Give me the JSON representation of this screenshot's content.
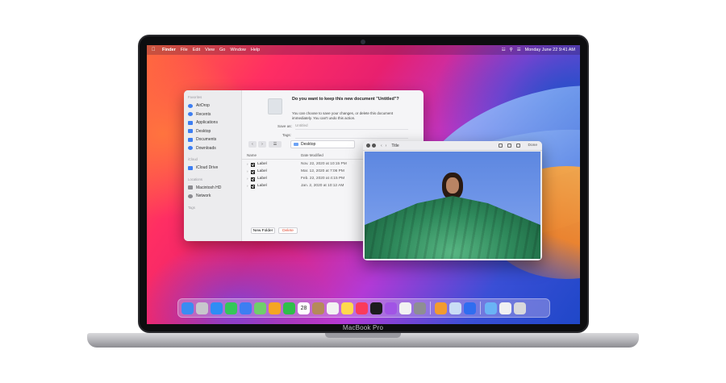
{
  "menubar": {
    "app": "Finder",
    "items": [
      "File",
      "Edit",
      "View",
      "Go",
      "Window",
      "Help"
    ],
    "clock": "Monday June 22  9:41 AM"
  },
  "sheet": {
    "prompt_title": "Do you want to keep this new document \"Untitled\"?",
    "prompt_body": "You can choose to save your changes, or delete this document immediately. You can't undo this action.",
    "save_as_label": "Save as:",
    "save_as_value": "Untitled",
    "tags_label": "Tags:",
    "location": "Desktop",
    "sidebar": {
      "sections": [
        {
          "title": "Favorites",
          "items": [
            "AirDrop",
            "Recents",
            "Applications",
            "Desktop",
            "Documents",
            "Downloads"
          ]
        },
        {
          "title": "iCloud",
          "items": [
            "iCloud Drive"
          ]
        },
        {
          "title": "Locations",
          "items": [
            "Macintosh HD",
            "Network"
          ]
        },
        {
          "title": "Tags",
          "items": []
        }
      ]
    },
    "table": {
      "col_name": "Name",
      "col_date": "Date Modified",
      "rows": [
        {
          "name": "Label",
          "date": "Nov. 22, 2020 at 10:15 PM"
        },
        {
          "name": "Label",
          "date": "Mar. 12, 2020 at 7:06 PM"
        },
        {
          "name": "Label",
          "date": "Feb. 22, 2020 at 4:15 PM"
        },
        {
          "name": "Label",
          "date": "Jan. 2, 2020 at 10:12 AM"
        }
      ]
    },
    "new_folder_label": "New Folder",
    "delete_label": "Delete"
  },
  "photo_window": {
    "title": "Title",
    "done_label": "Done"
  },
  "dock": {
    "icons": [
      {
        "name": "finder-icon",
        "color": "#3b8cf1"
      },
      {
        "name": "launchpad-icon",
        "color": "#c7c7cc"
      },
      {
        "name": "safari-icon",
        "color": "#2e8df5"
      },
      {
        "name": "messages-icon",
        "color": "#34c759"
      },
      {
        "name": "mail-icon",
        "color": "#3d7ef2"
      },
      {
        "name": "maps-icon",
        "color": "#6fcf6a"
      },
      {
        "name": "photos-icon",
        "color": "#f5a623"
      },
      {
        "name": "facetime-icon",
        "color": "#2fbf4a"
      },
      {
        "name": "calendar-icon",
        "color": "#ffffff"
      },
      {
        "name": "contacts-icon",
        "color": "#b58a5a"
      },
      {
        "name": "reminders-icon",
        "color": "#f2f2f2"
      },
      {
        "name": "notes-icon",
        "color": "#ffd84d"
      },
      {
        "name": "music-icon",
        "color": "#fa3b5b"
      },
      {
        "name": "tv-icon",
        "color": "#1c1c1e"
      },
      {
        "name": "podcasts-icon",
        "color": "#a154e5"
      },
      {
        "name": "news-icon",
        "color": "#f2f2f2"
      },
      {
        "name": "system-preferences-icon",
        "color": "#8e8e93"
      },
      {
        "name": "separator",
        "color": ""
      },
      {
        "name": "pages-icon",
        "color": "#f29b2f"
      },
      {
        "name": "preview-icon",
        "color": "#c9ddf5"
      },
      {
        "name": "keynote-icon",
        "color": "#2f6df0"
      },
      {
        "name": "separator",
        "color": ""
      },
      {
        "name": "folder-icon",
        "color": "#6ab3f5"
      },
      {
        "name": "document-icon",
        "color": "#f0f0f2"
      },
      {
        "name": "trash-icon",
        "color": "#d8d8dc"
      }
    ],
    "calendar_day": "28"
  },
  "device": {
    "model": "MacBook Pro"
  }
}
